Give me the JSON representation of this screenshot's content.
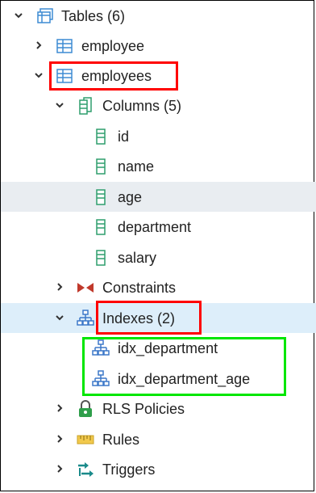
{
  "tree": {
    "tables": {
      "label": "Tables (6)",
      "icon": "tables-group-icon"
    },
    "employee": {
      "label": "employee",
      "icon": "table-icon"
    },
    "employees": {
      "label": "employees",
      "icon": "table-icon"
    },
    "columns": {
      "label": "Columns (5)",
      "icon": "columns-icon"
    },
    "column_items": [
      {
        "label": "id",
        "icon": "column-icon"
      },
      {
        "label": "name",
        "icon": "column-icon"
      },
      {
        "label": "age",
        "icon": "column-icon"
      },
      {
        "label": "department",
        "icon": "column-icon"
      },
      {
        "label": "salary",
        "icon": "column-icon"
      }
    ],
    "constraints": {
      "label": "Constraints",
      "icon": "constraints-icon"
    },
    "indexes": {
      "label": "Indexes (2)",
      "icon": "indexes-icon"
    },
    "index_items": [
      {
        "label": "idx_department",
        "icon": "index-icon"
      },
      {
        "label": "idx_department_age",
        "icon": "index-icon"
      }
    ],
    "rls_policies": {
      "label": "RLS Policies",
      "icon": "rls-lock-icon"
    },
    "rules": {
      "label": "Rules",
      "icon": "rules-icon"
    },
    "triggers": {
      "label": "Triggers",
      "icon": "triggers-icon"
    }
  },
  "colors": {
    "table_icon": "#3d8bd3",
    "column_icon": "#2e9e6d",
    "index_icon": "#3d78c9",
    "constraints_icon": "#c0392b",
    "hover_row": "#e9edf1",
    "selected_row": "#ddeefa",
    "annotation_red": "#ff0000",
    "annotation_green": "#00e600"
  }
}
